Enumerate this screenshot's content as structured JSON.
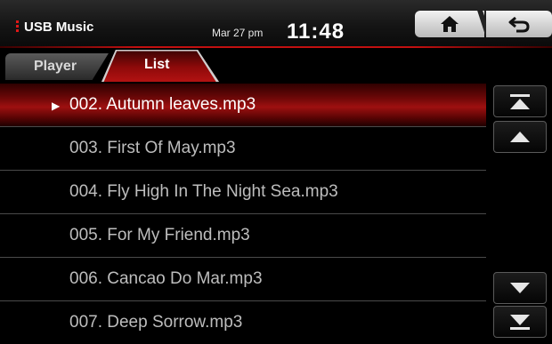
{
  "header": {
    "source_title": "USB Music",
    "date": "Mar 27 pm",
    "time": "11:48",
    "home_icon": "home-icon",
    "back_icon": "back-arrow-icon"
  },
  "tabs": [
    {
      "label": "Player",
      "active": false
    },
    {
      "label": "List",
      "active": true
    }
  ],
  "playlist": {
    "selected_index": 0,
    "items": [
      {
        "label": "002. Autumn leaves.mp3"
      },
      {
        "label": "003. First Of May.mp3"
      },
      {
        "label": "004. Fly High In The Night Sea.mp3"
      },
      {
        "label": "005. For My Friend.mp3"
      },
      {
        "label": "006. Cancao Do Mar.mp3"
      },
      {
        "label": "007. Deep Sorrow.mp3"
      }
    ]
  },
  "scroll_controls": [
    "scroll-top-icon",
    "page-up-icon",
    "page-down-icon",
    "scroll-bottom-icon"
  ],
  "colors": {
    "accent": "#b31212",
    "selected_row": "#9e1010",
    "text_dim": "#bdbdbd"
  }
}
